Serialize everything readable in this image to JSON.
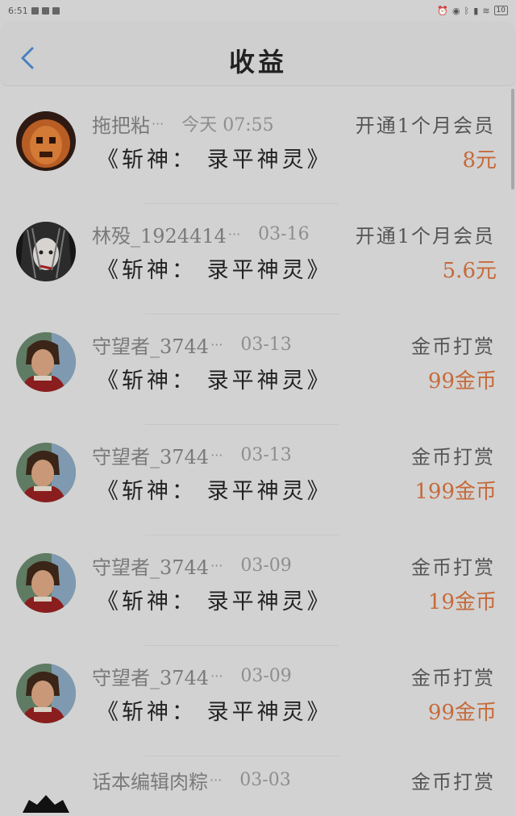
{
  "status": {
    "time": "6:51",
    "battery": "10"
  },
  "header": {
    "title": "收益"
  },
  "items": [
    {
      "user": "拖把粘",
      "time": "今天 07:55",
      "action": "开通1个月会员",
      "book": "《斩神：  录平神灵》",
      "amount": "8元"
    },
    {
      "user": "林殁_1924414",
      "time": "03-16",
      "action": "开通1个月会员",
      "book": "《斩神：  录平神灵》",
      "amount": "5.6元"
    },
    {
      "user": "守望者_3744",
      "time": "03-13",
      "action": "金币打赏",
      "book": "《斩神：  录平神灵》",
      "amount": "99金币"
    },
    {
      "user": "守望者_3744",
      "time": "03-13",
      "action": "金币打赏",
      "book": "《斩神：  录平神灵》",
      "amount": "199金币"
    },
    {
      "user": "守望者_3744",
      "time": "03-09",
      "action": "金币打赏",
      "book": "《斩神：  录平神灵》",
      "amount": "19金币"
    },
    {
      "user": "守望者_3744",
      "time": "03-09",
      "action": "金币打赏",
      "book": "《斩神：  录平神灵》",
      "amount": "99金币"
    }
  ],
  "partial": {
    "user": "话本编辑肉粽",
    "time": "03-03",
    "action": "金币打赏"
  },
  "colors": {
    "amount": "#c66a3a",
    "back_icon": "#4a7fc0"
  }
}
